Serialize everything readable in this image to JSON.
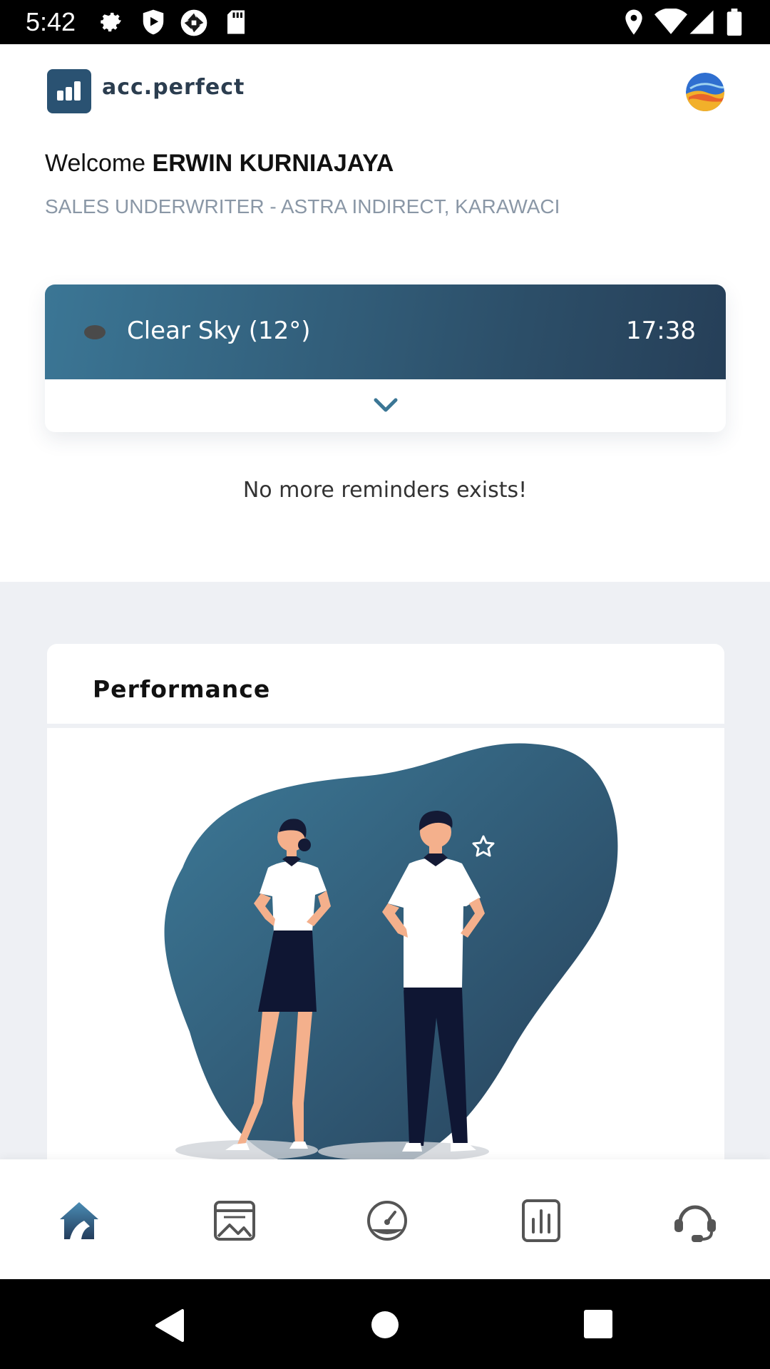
{
  "status_bar": {
    "time": "5:42"
  },
  "header": {
    "app_name": "acc.perfect"
  },
  "user": {
    "welcome_prefix": "Welcome ",
    "name": "ERWIN KURNIAJAYA",
    "role": "SALES UNDERWRITER - ASTRA INDIRECT, KARAWACI"
  },
  "weather": {
    "condition": "Clear Sky (12°)",
    "time": "17:38"
  },
  "reminders": {
    "empty_text": "No more reminders exists!"
  },
  "performance": {
    "title": "Performance"
  },
  "colors": {
    "primary_dark": "#2c4e68",
    "primary": "#3b7695",
    "background_grey": "#eef0f4",
    "nav_icon": "#444444"
  },
  "bottom_nav": [
    "home-icon",
    "gallery-icon",
    "speedometer-icon",
    "bar-chart-icon",
    "headset-icon"
  ]
}
